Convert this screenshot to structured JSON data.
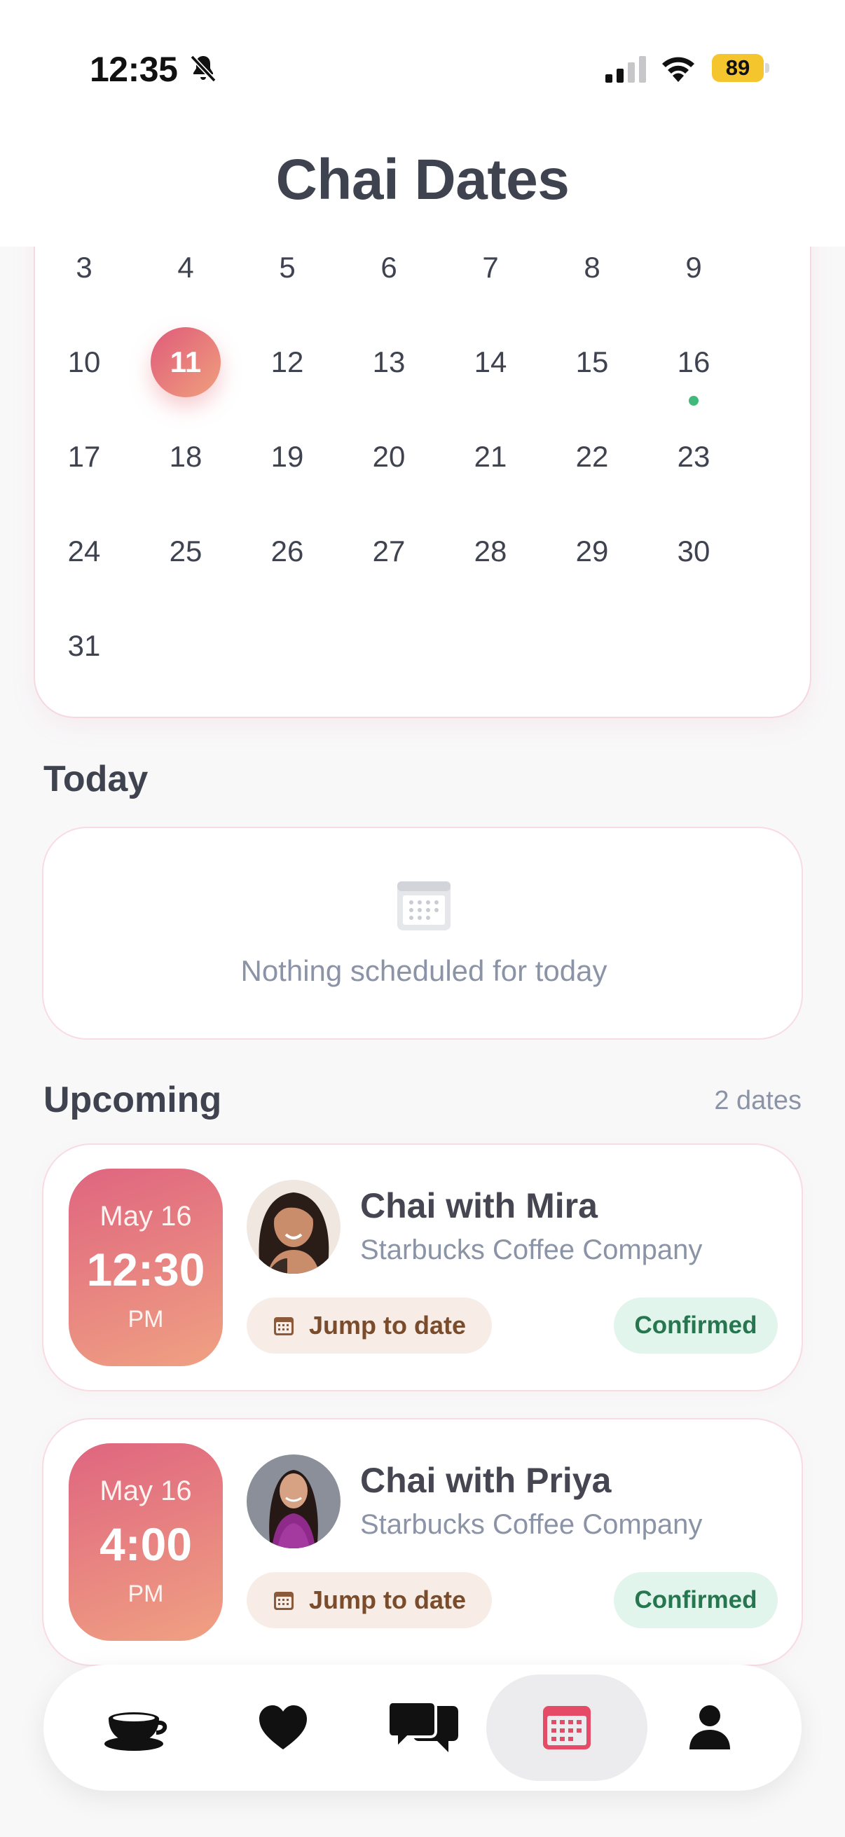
{
  "status_bar": {
    "time": "12:35",
    "battery": "89"
  },
  "header": {
    "title": "Chai Dates"
  },
  "calendar": {
    "weeks": [
      [
        "3",
        "4",
        "5",
        "6",
        "7",
        "8",
        "9"
      ],
      [
        "10",
        "11",
        "12",
        "13",
        "14",
        "15",
        "16"
      ],
      [
        "17",
        "18",
        "19",
        "20",
        "21",
        "22",
        "23"
      ],
      [
        "24",
        "25",
        "26",
        "27",
        "28",
        "29",
        "30"
      ],
      [
        "31"
      ]
    ],
    "selected_day": "11",
    "event_days": [
      "16"
    ],
    "event_dot_color": "#41b97a",
    "accent_gradient": [
      "#df5b7a",
      "#f0a07d"
    ]
  },
  "today": {
    "heading": "Today",
    "empty_message": "Nothing scheduled for today",
    "empty_icon": "calendar-icon"
  },
  "upcoming": {
    "heading": "Upcoming",
    "count_label": "2 dates",
    "items": [
      {
        "date": "May 16",
        "time": "12:30",
        "ampm": "PM",
        "title": "Chai with Mira",
        "venue": "Starbucks Coffee Company",
        "jump_label": "Jump to date",
        "status": "Confirmed",
        "status_color": "#26764f"
      },
      {
        "date": "May 16",
        "time": "4:00",
        "ampm": "PM",
        "title": "Chai with Priya",
        "venue": "Starbucks Coffee Company",
        "jump_label": "Jump to date",
        "status": "Confirmed",
        "status_color": "#26764f"
      }
    ]
  },
  "bottom_nav": {
    "items": [
      {
        "icon": "coffee-cup-icon",
        "active": false
      },
      {
        "icon": "heart-icon",
        "active": false
      },
      {
        "icon": "chat-bubbles-icon",
        "active": false
      },
      {
        "icon": "calendar-icon",
        "active": true,
        "color": "#e54a66"
      },
      {
        "icon": "user-icon",
        "active": false
      }
    ]
  }
}
